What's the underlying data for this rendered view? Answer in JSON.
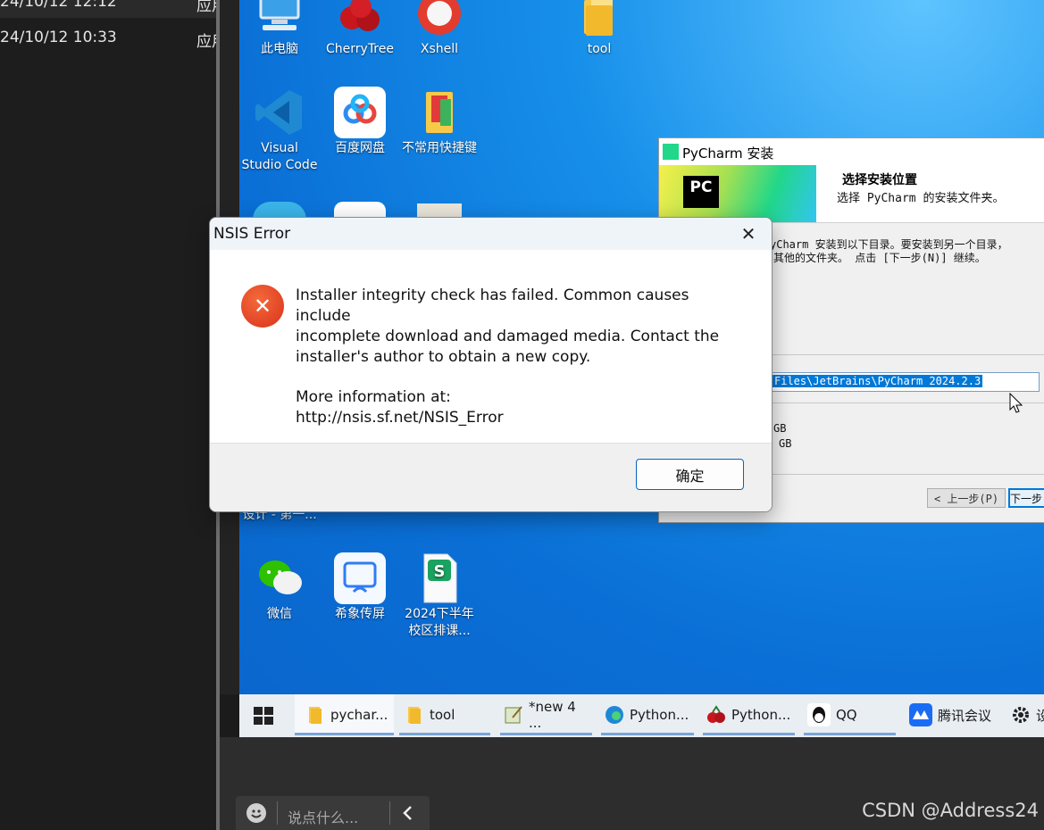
{
  "left_panel": {
    "rows": [
      {
        "date": "24/10/12 12:12",
        "tag": "应用"
      },
      {
        "date": "24/10/12 10:33",
        "tag": "应用"
      }
    ]
  },
  "desktop": {
    "icons": [
      {
        "label": "此电脑",
        "icon": "computer-icon"
      },
      {
        "label": "CherryTree",
        "icon": "cherrytree-icon"
      },
      {
        "label": "Xshell",
        "icon": "xshell-icon"
      },
      {
        "label": "tool",
        "icon": "folder-icon"
      },
      {
        "label": "Visual Studio Code",
        "icon": "vscode-icon"
      },
      {
        "label": "百度网盘",
        "icon": "baidu-netdisk-icon"
      },
      {
        "label": "不常用快捷键",
        "icon": "folder-icon"
      },
      {
        "label": "设计 - 第一...",
        "icon": "document-icon"
      },
      {
        "label": "微信",
        "icon": "wechat-icon"
      },
      {
        "label": "希象传屏",
        "icon": "cast-screen-icon"
      },
      {
        "label": "2024下半年校区排课...",
        "icon": "spreadsheet-icon"
      }
    ]
  },
  "pycharm_installer": {
    "title": "PyCharm 安装",
    "logo_text": "PC",
    "heading": "选择安装位置",
    "subheading": "选择 PyCharm 的安装文件夹。",
    "body_line1": "yCharm 安装到以下目录。要安装到另一个目录，",
    "body_line2": "其他的文件夹。 点击 [下一步(N)] 继续。",
    "path_value": "Files\\JetBrains\\PyCharm 2024.2.3",
    "space_required": "GB",
    "space_available": "GB",
    "back_button": "< 上一步(P)",
    "next_button": "下一步"
  },
  "nsis_dialog": {
    "title": "NSIS Error",
    "close_glyph": "✕",
    "error_glyph": "✕",
    "message_line1": "Installer integrity check has failed. Common causes include",
    "message_line2": "incomplete download and damaged media. Contact the",
    "message_line3": "installer's author to obtain a new copy.",
    "more_info": "More information at:",
    "link": "http://nsis.sf.net/NSIS_Error",
    "ok_button": "确定"
  },
  "taskbar": {
    "items": [
      {
        "label": "pychar...",
        "icon": "folder-icon"
      },
      {
        "label": "tool",
        "icon": "folder-icon"
      },
      {
        "label": "*new 4 ...",
        "icon": "notepad-icon"
      },
      {
        "label": "Python...",
        "icon": "edge-icon"
      },
      {
        "label": "Python...",
        "icon": "cherrytree-icon"
      },
      {
        "label": "QQ",
        "icon": "qq-icon"
      },
      {
        "label": "腾讯会议",
        "icon": "tencent-meeting-icon"
      },
      {
        "label": "设",
        "icon": "settings-icon"
      }
    ]
  },
  "chat_bar": {
    "placeholder": "说点什么..."
  },
  "watermark": "CSDN @Address24"
}
